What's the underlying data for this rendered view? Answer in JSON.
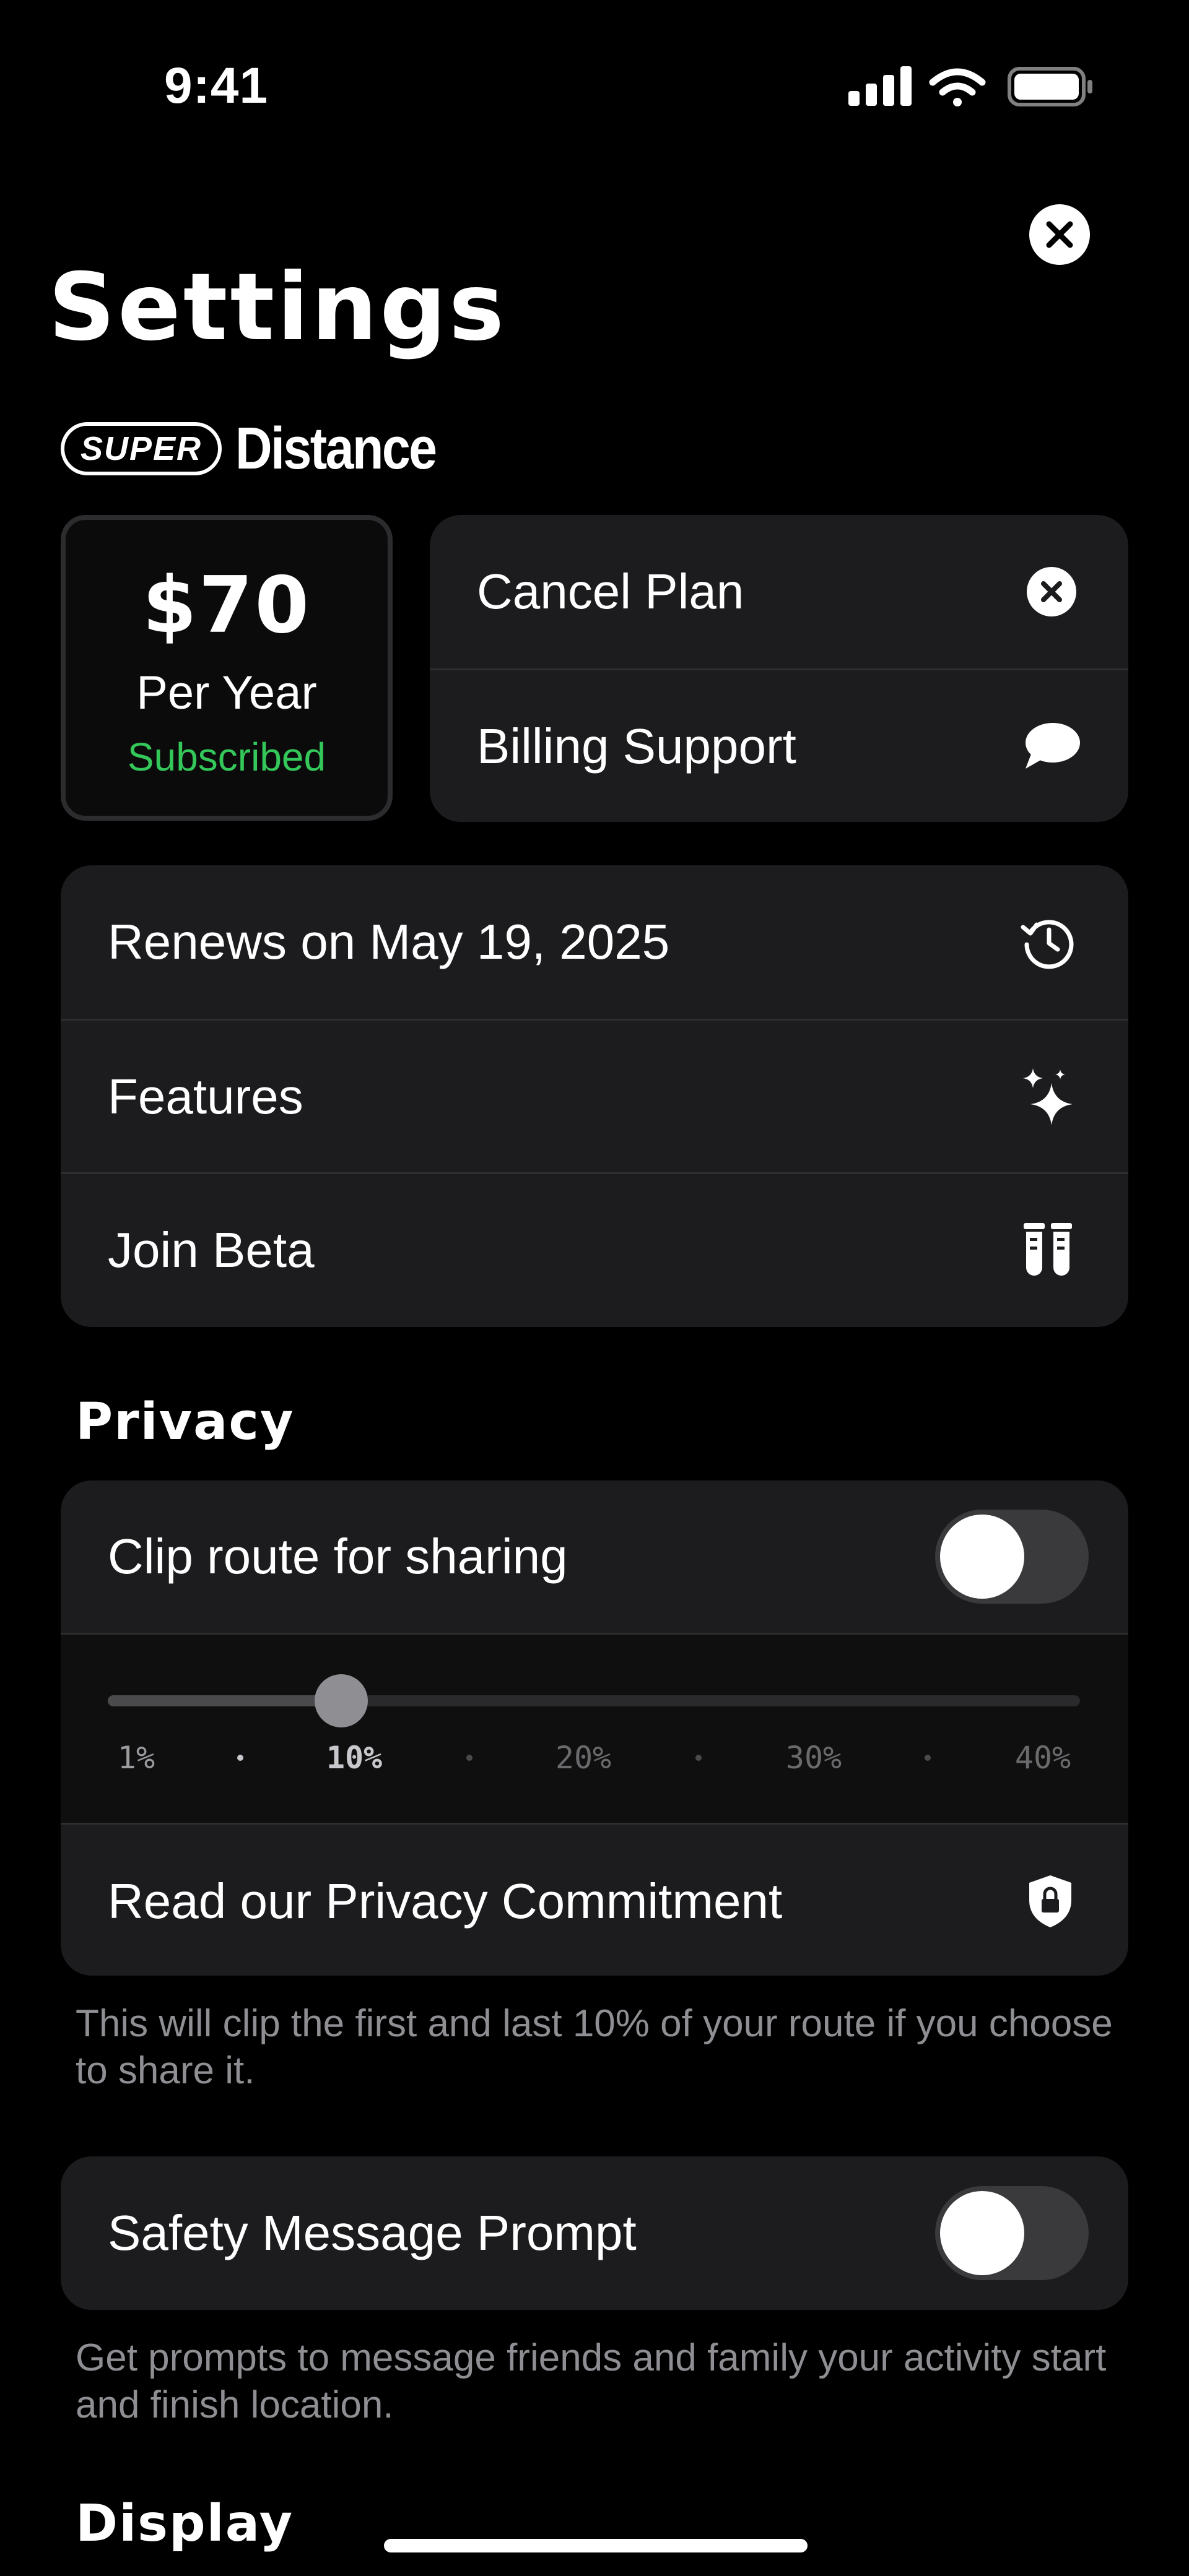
{
  "status_bar": {
    "time": "9:41",
    "signal_icon": "cellular-signal-icon",
    "wifi_icon": "wifi-icon",
    "battery_icon": "battery-icon"
  },
  "header": {
    "title": "Settings",
    "close_icon": "close-icon"
  },
  "brand": {
    "pill": "SUPER",
    "word": "Distance"
  },
  "plan": {
    "price": "$70",
    "period": "Per Year",
    "status": "Subscribed",
    "status_color": "#34c759"
  },
  "plan_actions": [
    {
      "label": "Cancel Plan",
      "icon": "x-circle-icon"
    },
    {
      "label": "Billing Support",
      "icon": "speech-bubble-icon"
    }
  ],
  "account_rows": [
    {
      "label": "Renews on May 19, 2025",
      "icon": "history-icon"
    },
    {
      "label": "Features",
      "icon": "sparkles-icon"
    },
    {
      "label": "Join Beta",
      "icon": "test-tubes-icon"
    }
  ],
  "privacy": {
    "section_title": "Privacy",
    "clip_label": "Clip route for sharing",
    "clip_enabled": false,
    "slider": {
      "ticks": [
        "1%",
        "10%",
        "20%",
        "30%",
        "40%"
      ],
      "selected": "10%",
      "value_fraction": 0.24
    },
    "commitment_label": "Read our Privacy Commitment",
    "commitment_icon": "shield-lock-icon",
    "footnote": "This will clip the first and last 10% of your route if you choose to share it."
  },
  "safety": {
    "label": "Safety Message Prompt",
    "enabled": false,
    "footnote": "Get prompts to message friends and family your activity start and finish location."
  },
  "display": {
    "section_title": "Display"
  }
}
